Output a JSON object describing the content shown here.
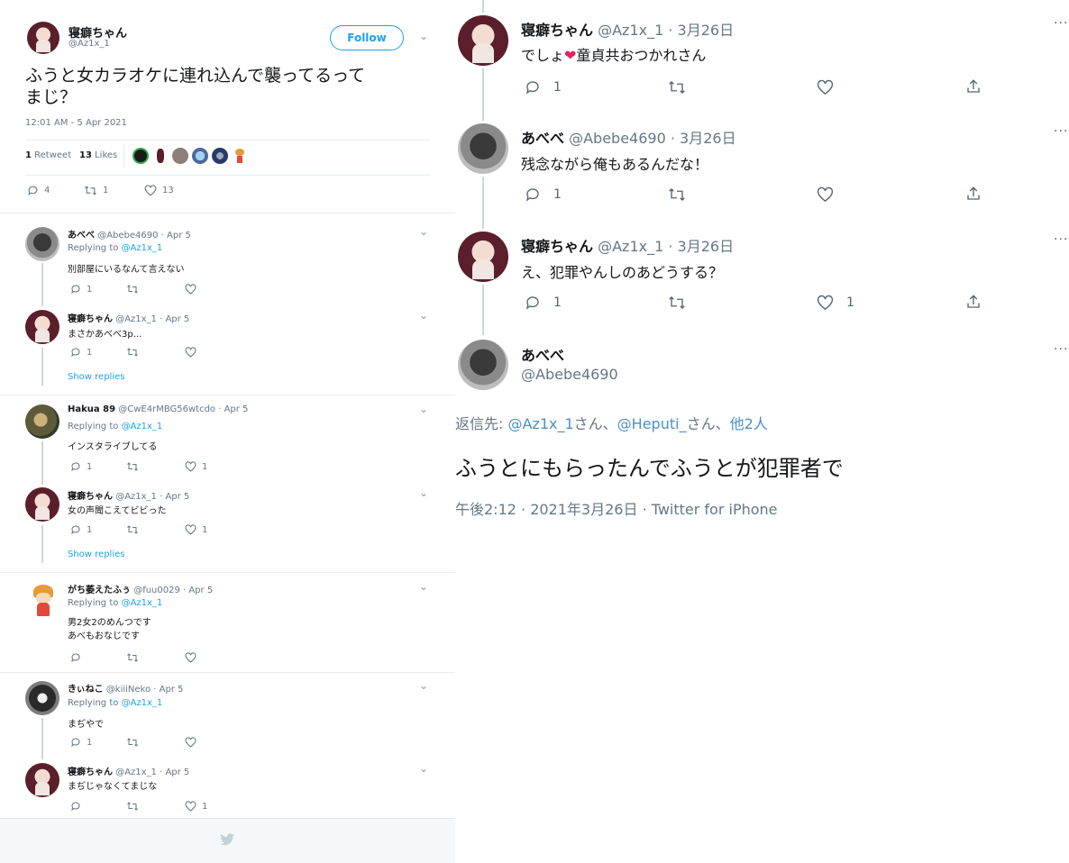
{
  "left": {
    "main_tweet": {
      "name": "寝癖ちゃん",
      "handle": "@Az1x_1",
      "follow_label": "Follow",
      "text_line1": "ふうと女カラオケに連れ込んで襲ってるって",
      "text_line2": "まじ？",
      "timestamp": "12:01 AM - 5 Apr 2021",
      "retweets_count": "1",
      "retweets_label": "Retweet",
      "likes_count": "13",
      "likes_label": "Likes",
      "reply_count": "4",
      "retweet_count_action": "1",
      "like_count_action": "13"
    },
    "replies": [
      {
        "name": "あべべ",
        "meta": "@Abebe4690 · Apr 5",
        "replying_prefix": "Replying to ",
        "replying_handle": "@Az1x_1",
        "text": "別部屋にいるなんて言えない",
        "reply_count": "1",
        "retweet_count": "",
        "like_count": ""
      },
      {
        "name": "寝癖ちゃん",
        "meta": "@Az1x_1 · Apr 5",
        "text": "まさかあべべ3p...",
        "reply_count": "1",
        "retweet_count": "",
        "like_count": ""
      },
      {
        "name": "Hakua 89",
        "meta": "@CwE4rMBG56wtcdo · Apr 5",
        "replying_prefix": "Replying to ",
        "replying_handle": "@Az1x_1",
        "text": "インスタライブしてる",
        "reply_count": "1",
        "retweet_count": "",
        "like_count": "1"
      },
      {
        "name": "寝癖ちゃん",
        "meta": "@Az1x_1 · Apr 5",
        "text": "女の声聞こえてビビった",
        "reply_count": "1",
        "retweet_count": "",
        "like_count": "1"
      },
      {
        "name": "がち萎えたふぅ",
        "meta": "@fuu0029 · Apr 5",
        "replying_prefix": "Replying to ",
        "replying_handle": "@Az1x_1",
        "text_line1": "男2女2のめんつです",
        "text_line2": "あべもおなじです",
        "reply_count": "",
        "retweet_count": "",
        "like_count": ""
      },
      {
        "name": "きぃねこ",
        "meta": "@kiiiNeko · Apr 5",
        "replying_prefix": "Replying to ",
        "replying_handle": "@Az1x_1",
        "text": "まぢやで",
        "reply_count": "1",
        "retweet_count": "",
        "like_count": ""
      },
      {
        "name": "寝癖ちゃん",
        "meta": "@Az1x_1 · Apr 5",
        "text": "まぢじゃなくてまじな",
        "reply_count": "",
        "retweet_count": "",
        "like_count": "1"
      }
    ],
    "show_replies_label": "Show replies"
  },
  "right": {
    "tweets": [
      {
        "name": "寝癖ちゃん",
        "meta": "@Az1x_1 · 3月26日",
        "text_before": "でしょ",
        "text_after": "童貞共おつかれさん",
        "reply_count": "1",
        "like_count": ""
      },
      {
        "name": "あべべ",
        "meta": "@Abebe4690 · 3月26日",
        "text": "残念ながら俺もあるんだな！",
        "reply_count": "1",
        "like_count": ""
      },
      {
        "name": "寝癖ちゃん",
        "meta": "@Az1x_1 · 3月26日",
        "text": "え、犯罪やんしのあどうする？",
        "reply_count": "1",
        "like_count": "1"
      }
    ],
    "focus": {
      "name": "あべべ",
      "handle": "@Abebe4690",
      "replying_prefix": "返信先: ",
      "replying_1": "@Az1x_1",
      "replying_sep1": "さん、",
      "replying_2": "@Heputi_",
      "replying_sep2": "さん、",
      "replying_3": "他2人",
      "text": "ふうとにもらったんでふうとが犯罪者で",
      "footer": "午後2:12 · 2021年3月26日 · Twitter for iPhone"
    }
  },
  "colors": {
    "twitter_blue": "#1da1f2",
    "muted": "#657786",
    "heart": "#e0245e"
  }
}
